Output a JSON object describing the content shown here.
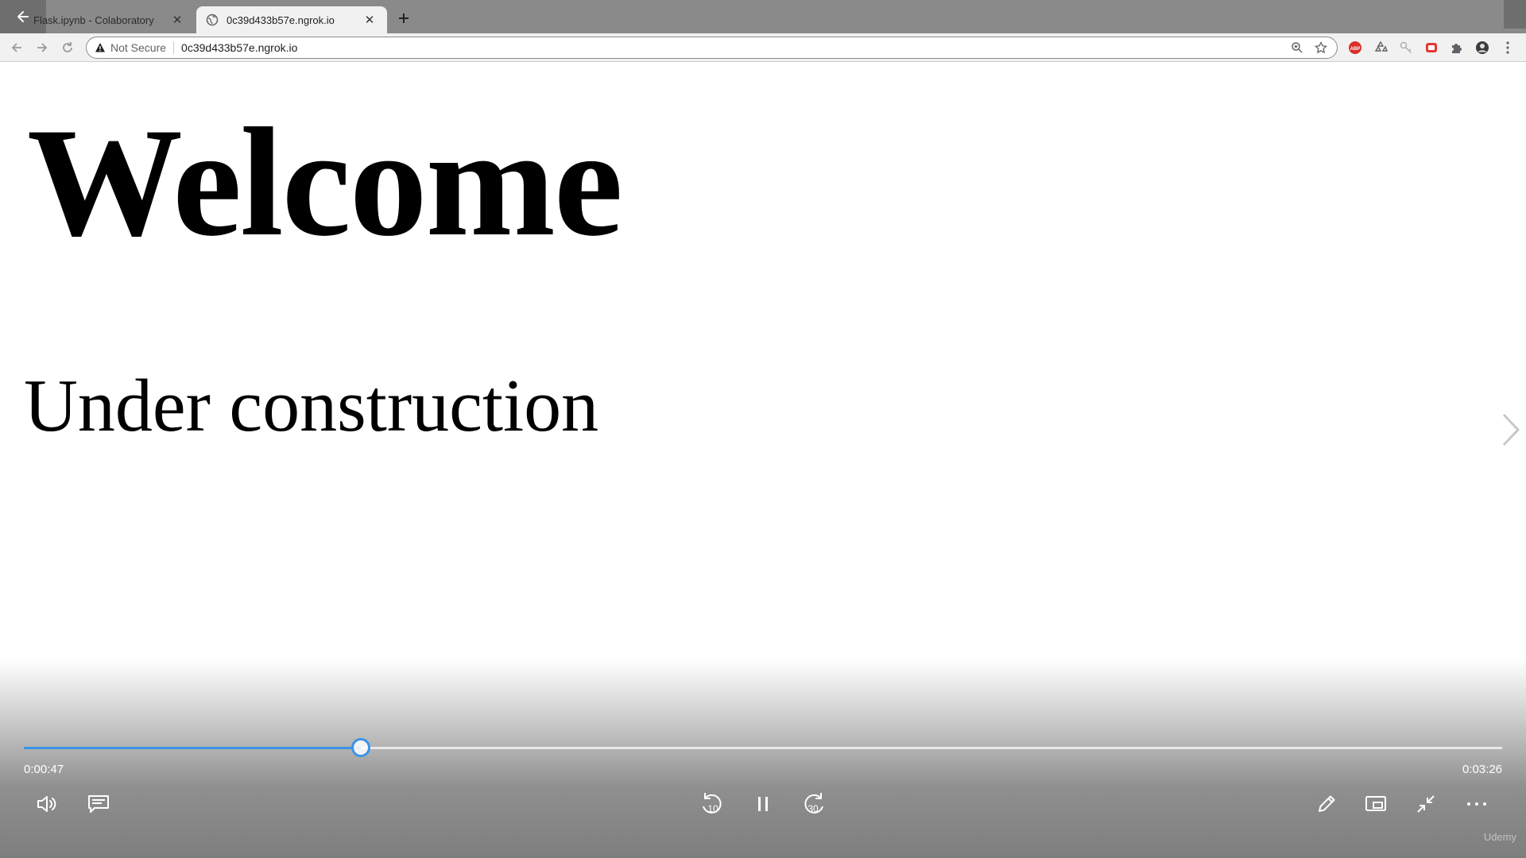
{
  "browser": {
    "tabs": [
      {
        "title": "Flask.ipynb - Colaboratory",
        "active": false
      },
      {
        "title": "0c39d433b57e.ngrok.io",
        "active": true
      }
    ],
    "security_label": "Not Secure",
    "url": "0c39d433b57e.ngrok.io"
  },
  "page": {
    "heading": "Welcome",
    "subheading": "Under construction"
  },
  "player": {
    "current_time": "0:00:47",
    "total_time": "0:03:26",
    "progress_fraction": 0.228,
    "rewind_seconds": "10",
    "forward_seconds": "30",
    "accent_color": "#3a94e8",
    "watermark": "Udemy"
  }
}
